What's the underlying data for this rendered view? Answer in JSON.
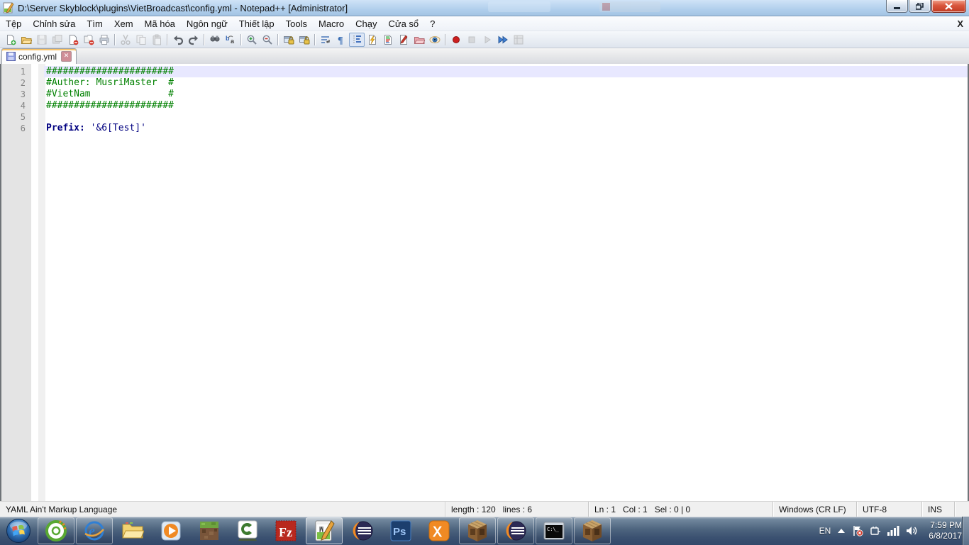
{
  "window": {
    "title": "D:\\Server Skyblock\\plugins\\VietBroadcast\\config.yml - Notepad++ [Administrator]",
    "controls": {
      "minimize": "minimize",
      "maximize": "maximize",
      "close": "close"
    }
  },
  "menu": {
    "items": [
      "Tệp",
      "Chỉnh sửa",
      "Tìm",
      "Xem",
      "Mã hóa",
      "Ngôn ngữ",
      "Thiết lập",
      "Tools",
      "Macro",
      "Chạy",
      "Cửa sổ",
      "?"
    ],
    "close_label": "X"
  },
  "toolbar": {
    "icons": [
      "new-file",
      "open-file",
      "save-file",
      "save-all",
      "close-file",
      "close-all",
      "print",
      "|",
      "cut",
      "copy",
      "paste",
      "|",
      "undo",
      "redo",
      "|",
      "find",
      "replace",
      "|",
      "zoom-in",
      "zoom-out",
      "|",
      "sync-vertical-scroll",
      "sync-horizontal-scroll",
      "|",
      "word-wrap",
      "show-all-characters",
      "indent-guide",
      "function-list",
      "document-map",
      "define-language",
      "folder-as-workspace",
      "monitoring-eye",
      "|",
      "macro-record",
      "macro-stop",
      "macro-play",
      "macro-run-multiple",
      "macro-save"
    ],
    "pressed": "indent-guide",
    "disabled": [
      "save-file",
      "save-all",
      "cut",
      "copy",
      "paste",
      "macro-stop",
      "macro-play",
      "macro-save"
    ]
  },
  "tabbar": {
    "tabs": [
      {
        "label": "config.yml",
        "saved": true
      }
    ]
  },
  "editor": {
    "lines": [
      {
        "num": "1",
        "current": true,
        "parts": [
          {
            "t": "#######################",
            "c": "comment"
          }
        ]
      },
      {
        "num": "2",
        "current": false,
        "parts": [
          {
            "t": "#Auther: MusriMaster  #",
            "c": "comment"
          }
        ]
      },
      {
        "num": "3",
        "current": false,
        "parts": [
          {
            "t": "#VietNam              #",
            "c": "comment"
          }
        ]
      },
      {
        "num": "4",
        "current": false,
        "parts": [
          {
            "t": "#######################",
            "c": "comment"
          }
        ]
      },
      {
        "num": "5",
        "current": false,
        "parts": []
      },
      {
        "num": "6",
        "current": false,
        "parts": [
          {
            "t": "Prefix: ",
            "c": "key"
          },
          {
            "t": "'&6[Test]'",
            "c": "str"
          }
        ]
      }
    ]
  },
  "statusbar": {
    "doc_type": "YAML Ain't Markup Language",
    "length_lines": "length : 120   lines : 6",
    "position": "Ln : 1   Col : 1   Sel : 0 | 0",
    "eol": "Windows (CR LF)",
    "encoding": "UTF-8",
    "insert_mode": "INS"
  },
  "taskbar": {
    "items": [
      {
        "name": "start-button",
        "icon": "start-orb",
        "state": "start"
      },
      {
        "name": "coccoc-browser",
        "icon": "coccoc",
        "state": "open"
      },
      {
        "name": "internet-explorer",
        "icon": "ie",
        "state": "open"
      },
      {
        "name": "windows-explorer",
        "icon": "explorer",
        "state": "pinned"
      },
      {
        "name": "windows-media-player",
        "icon": "wmp",
        "state": "pinned"
      },
      {
        "name": "minecraft",
        "icon": "minecraft",
        "state": "pinned"
      },
      {
        "name": "camtasia",
        "icon": "camtasia",
        "state": "pinned"
      },
      {
        "name": "filezilla",
        "icon": "filezilla",
        "state": "pinned"
      },
      {
        "name": "notepad-plus-plus",
        "icon": "npp",
        "state": "active"
      },
      {
        "name": "eclipse",
        "icon": "eclipse",
        "state": "pinned"
      },
      {
        "name": "photoshop",
        "icon": "photoshop",
        "state": "pinned"
      },
      {
        "name": "xampp",
        "icon": "xampp",
        "state": "pinned"
      },
      {
        "name": "minecraft-server-window-1",
        "icon": "crafting-table",
        "state": "open"
      },
      {
        "name": "eclipse-window",
        "icon": "eclipse",
        "state": "open"
      },
      {
        "name": "command-prompt",
        "icon": "cmd",
        "state": "open"
      },
      {
        "name": "minecraft-server-window-2",
        "icon": "crafting-table",
        "state": "open"
      }
    ],
    "tray": {
      "language": "EN",
      "icons": [
        "hidden-icons-arrow",
        "action-center-flag",
        "power-plug",
        "network-signal",
        "volume-speaker"
      ],
      "time": "7:59 PM",
      "date": "6/8/2017"
    }
  }
}
